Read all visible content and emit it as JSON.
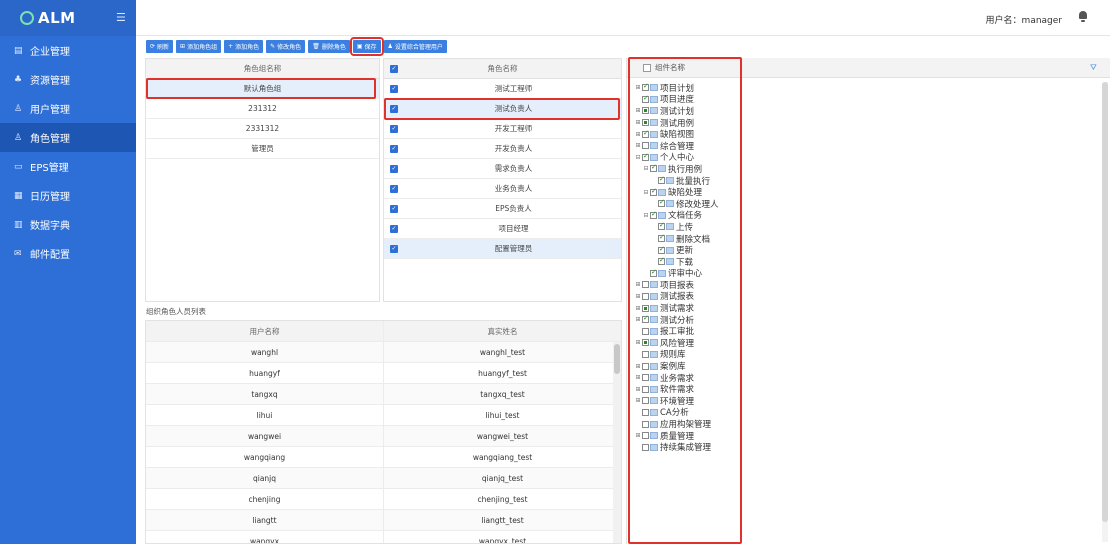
{
  "app": {
    "logo": "ALM",
    "user_label": "用户名：manager"
  },
  "sidebar": {
    "items": [
      {
        "label": "企业管理",
        "icon": "building-icon"
      },
      {
        "label": "资源管理",
        "icon": "sitemap-icon"
      },
      {
        "label": "用户管理",
        "icon": "users-icon"
      },
      {
        "label": "角色管理",
        "icon": "role-icon",
        "active": true
      },
      {
        "label": "EPS管理",
        "icon": "folder-icon"
      },
      {
        "label": "日历管理",
        "icon": "calendar-icon"
      },
      {
        "label": "数据字典",
        "icon": "book-icon"
      },
      {
        "label": "邮件配置",
        "icon": "mail-icon"
      }
    ]
  },
  "toolbar": {
    "refresh": "刷新",
    "add_group": "添加角色组",
    "add_role": "添加角色",
    "edit_role": "修改角色",
    "delete_role": "删除角色",
    "save": "保存",
    "set_admin": "设置综合管理用户"
  },
  "role_groups": {
    "header": "角色组名称",
    "items": [
      "默认角色组",
      "231312",
      "2331312",
      "管理员"
    ]
  },
  "roles": {
    "header": "角色名称",
    "items": [
      "测试工程师",
      "测试负责人",
      "开发工程师",
      "开发负责人",
      "需求负责人",
      "业务负责人",
      "EPS负责人",
      "项目经理",
      "配置管理员"
    ]
  },
  "members": {
    "title": "组织角色人员列表",
    "headers": [
      "用户名称",
      "真实姓名"
    ],
    "rows": [
      [
        "wanghl",
        "wanghl_test"
      ],
      [
        "huangyf",
        "huangyf_test"
      ],
      [
        "tangxq",
        "tangxq_test"
      ],
      [
        "lihui",
        "lihui_test"
      ],
      [
        "wangwei",
        "wangwei_test"
      ],
      [
        "wangqiang",
        "wangqiang_test"
      ],
      [
        "qianjq",
        "qianjq_test"
      ],
      [
        "chenjing",
        "chenjing_test"
      ],
      [
        "liangtt",
        "liangtt_test"
      ],
      [
        "wangyx",
        "wangyx_test"
      ]
    ]
  },
  "tree": {
    "header": "组件名称",
    "nodes": [
      {
        "label": "项目计划",
        "depth": 0,
        "expand": "+",
        "state": "on"
      },
      {
        "label": "项目进度",
        "depth": 0,
        "expand": "",
        "state": "on"
      },
      {
        "label": "测试计划",
        "depth": 0,
        "expand": "+",
        "state": "half"
      },
      {
        "label": "测试用例",
        "depth": 0,
        "expand": "+",
        "state": "half"
      },
      {
        "label": "缺陷视图",
        "depth": 0,
        "expand": "+",
        "state": "on"
      },
      {
        "label": "综合管理",
        "depth": 0,
        "expand": "+",
        "state": "off"
      },
      {
        "label": "个人中心",
        "depth": 0,
        "expand": "−",
        "state": "on"
      },
      {
        "label": "执行用例",
        "depth": 1,
        "expand": "−",
        "state": "on"
      },
      {
        "label": "批量执行",
        "depth": 2,
        "expand": "",
        "state": "on"
      },
      {
        "label": "缺陷处理",
        "depth": 1,
        "expand": "−",
        "state": "on"
      },
      {
        "label": "修改处理人",
        "depth": 2,
        "expand": "",
        "state": "on"
      },
      {
        "label": "文档任务",
        "depth": 1,
        "expand": "−",
        "state": "on"
      },
      {
        "label": "上传",
        "depth": 2,
        "expand": "",
        "state": "on"
      },
      {
        "label": "删除文档",
        "depth": 2,
        "expand": "",
        "state": "on"
      },
      {
        "label": "更新",
        "depth": 2,
        "expand": "",
        "state": "on"
      },
      {
        "label": "下载",
        "depth": 2,
        "expand": "",
        "state": "on"
      },
      {
        "label": "评审中心",
        "depth": 1,
        "expand": "",
        "state": "on"
      },
      {
        "label": "项目报表",
        "depth": 0,
        "expand": "+",
        "state": "off"
      },
      {
        "label": "测试报表",
        "depth": 0,
        "expand": "+",
        "state": "off"
      },
      {
        "label": "测试需求",
        "depth": 0,
        "expand": "+",
        "state": "half"
      },
      {
        "label": "测试分析",
        "depth": 0,
        "expand": "+",
        "state": "on"
      },
      {
        "label": "报工审批",
        "depth": 0,
        "expand": "",
        "state": "off"
      },
      {
        "label": "风险管理",
        "depth": 0,
        "expand": "+",
        "state": "half"
      },
      {
        "label": "规则库",
        "depth": 0,
        "expand": "",
        "state": "off"
      },
      {
        "label": "案例库",
        "depth": 0,
        "expand": "+",
        "state": "off"
      },
      {
        "label": "业务需求",
        "depth": 0,
        "expand": "+",
        "state": "off"
      },
      {
        "label": "软件需求",
        "depth": 0,
        "expand": "+",
        "state": "off"
      },
      {
        "label": "环境管理",
        "depth": 0,
        "expand": "+",
        "state": "off"
      },
      {
        "label": "CA分析",
        "depth": 0,
        "expand": "",
        "state": "off"
      },
      {
        "label": "应用构架管理",
        "depth": 0,
        "expand": "",
        "state": "off"
      },
      {
        "label": "质量管理",
        "depth": 0,
        "expand": "+",
        "state": "off"
      },
      {
        "label": "持续集成管理",
        "depth": 0,
        "expand": "",
        "state": "off"
      }
    ]
  }
}
